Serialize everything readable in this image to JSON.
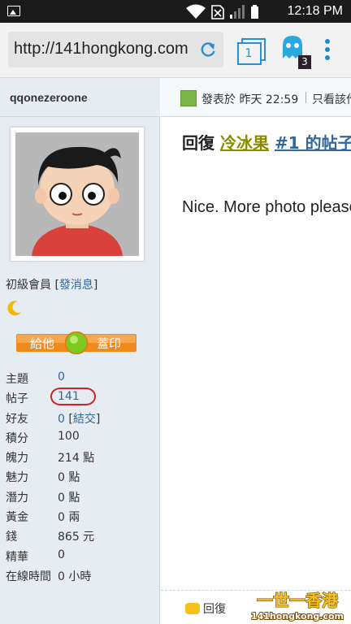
{
  "status_bar": {
    "time": "12:18 PM"
  },
  "browser": {
    "url": "http://141hongkong.com",
    "tab_count": "1",
    "ghost_badge": "3"
  },
  "sidebar": {
    "username": "qqonezeroone",
    "member_level": "初級會員",
    "send_message": "發消息",
    "stamp_left": "給他",
    "stamp_right": "蓋印",
    "stats": [
      {
        "label": "主題",
        "value": "0"
      },
      {
        "label": "帖子",
        "value": "141"
      },
      {
        "label": "好友",
        "value": "0",
        "extra": "結交"
      },
      {
        "label": "積分",
        "value": "100"
      },
      {
        "label": "魄力",
        "value": "214 點"
      },
      {
        "label": "魅力",
        "value": "0 點"
      },
      {
        "label": "潛力",
        "value": "0 點"
      },
      {
        "label": "黃金",
        "value": "0 兩"
      },
      {
        "label": "錢",
        "value": "865 元"
      },
      {
        "label": "精華",
        "value": "0"
      },
      {
        "label": "在線時間",
        "value": "0 小時"
      }
    ]
  },
  "post": {
    "posted_at": "發表於 昨天 22:59",
    "only_view": "只看該作者",
    "reply_prefix": "回復",
    "reply_user": "冷冰果",
    "reply_ref": "#1 的帖子",
    "content": "Nice. More photo please",
    "reply_button": "回復"
  },
  "watermark": {
    "line1": "一世一香港",
    "line2": "141hongkong.com"
  },
  "colors": {
    "link": "#336699",
    "sidebar_bg": "#e5edf2",
    "accent_orange": "#f08a1c",
    "circle": "#d42020"
  }
}
